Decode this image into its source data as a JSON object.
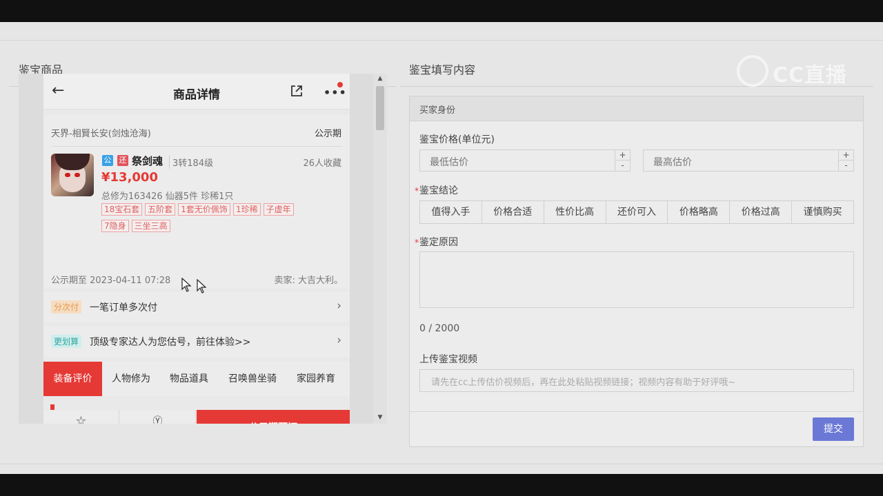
{
  "left_section": {
    "title": "鉴宝商品"
  },
  "right_section": {
    "title": "鉴宝填写内容"
  },
  "watermark": {
    "text": "CC直播"
  },
  "phone": {
    "header": {
      "title": "商品详情"
    },
    "card": {
      "server": "天界-相賢长安(剑烛沧海)",
      "period_label": "公示期",
      "badge_public": "公",
      "badge_return": "还",
      "char_name": "祭剑魂",
      "char_level": "3转184级",
      "fav_count": "26人收藏",
      "price": "¥13,000",
      "stats": "总修为163426 仙器5件 珍稀1只",
      "tags": [
        "18宝石套",
        "五阶套",
        "1套无价佩饰",
        "1珍稀",
        "子虚年",
        "7隐身",
        "三坐三高"
      ],
      "pub_until": "公示期至 2023-04-11 07:28",
      "seller": "卖家: 大吉大利。"
    },
    "rows": [
      {
        "chip": "分次付",
        "text": "一笔订单多次付"
      },
      {
        "chip": "更划算",
        "text": "顶级专家达人为您估号，前往体验>>"
      }
    ],
    "tabs": [
      "装备评价",
      "人物修为",
      "物品道具",
      "召唤兽坐骑",
      "家园养育"
    ],
    "actions": {
      "favorite": "收藏",
      "bargain": "还价",
      "reserve": "公示期预订"
    }
  },
  "form": {
    "buyer_section": "买家身份",
    "price_label": "鉴宝价格(单位元)",
    "min_placeholder": "最低估价",
    "max_placeholder": "最高估价",
    "plus": "+",
    "minus": "-",
    "conclusion_label": "鉴宝结论",
    "conclusions": [
      "值得入手",
      "价格合适",
      "性价比高",
      "还价可入",
      "价格略高",
      "价格过高",
      "谨慎购买"
    ],
    "reason_label": "鉴定原因",
    "counter": "0 / 2000",
    "video_label": "上传鉴宝视频",
    "video_placeholder": "请先在cc上传估价视频后，再在此处粘贴视频链接；视频内容有助于好评哦~",
    "submit": "提交",
    "required_mark": "*"
  }
}
